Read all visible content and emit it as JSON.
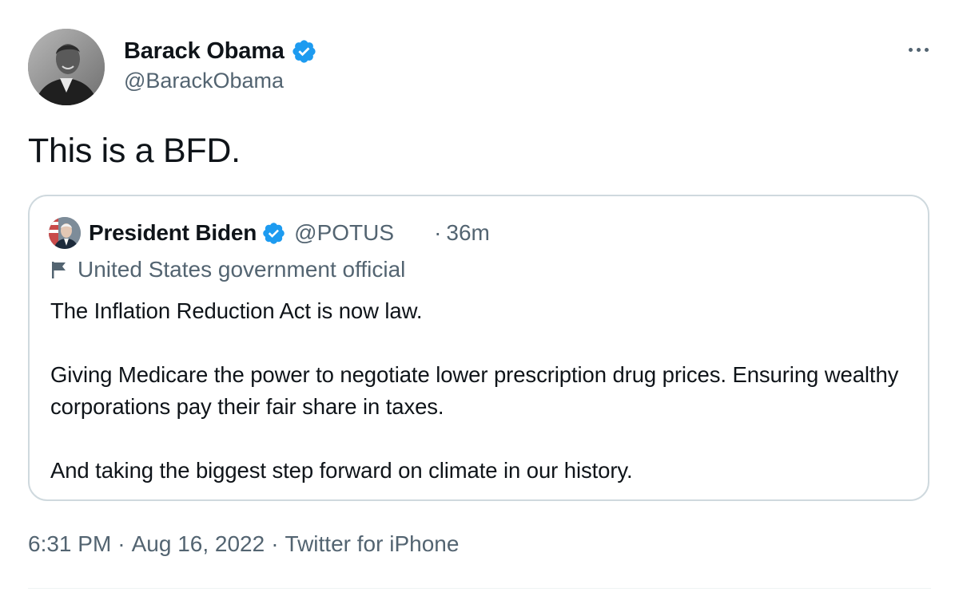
{
  "author": {
    "display_name": "Barack Obama",
    "handle": "@BarackObama"
  },
  "tweet": {
    "text": "This is a BFD."
  },
  "quoted_tweet": {
    "display_name": "President Biden",
    "handle": "@POTUS",
    "separator": "·",
    "time_ago": "36m",
    "label": "United States government official",
    "text": "The Inflation Reduction Act is now law.\n\nGiving Medicare the power to negotiate lower prescription drug prices. Ensuring wealthy corporations pay their fair share in taxes.\n\nAnd taking the biggest step forward on climate in our history."
  },
  "meta": {
    "time": "6:31 PM",
    "sep1": "·",
    "date": "Aug 16, 2022",
    "sep2": "·",
    "source": "Twitter for iPhone"
  },
  "icons": {
    "verified": "verified-badge-icon",
    "more": "more-options-icon",
    "flag": "flag-icon"
  },
  "colors": {
    "verified_blue": "#1d9bf0",
    "secondary_text": "#536471",
    "border": "#cfd9de"
  }
}
